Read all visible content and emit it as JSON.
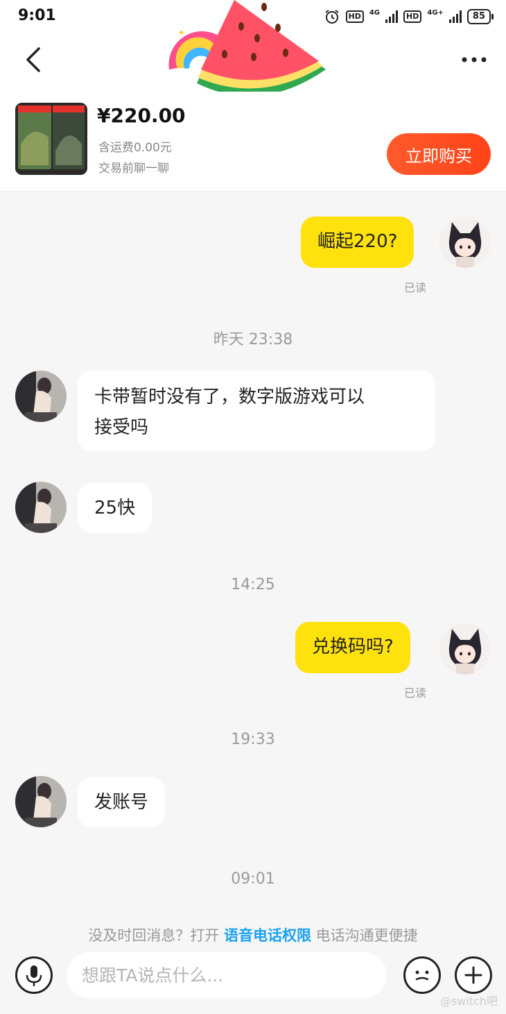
{
  "status_bar": {
    "time": "9:01",
    "hd1": "HD",
    "net1": "4G",
    "hd2": "HD",
    "net2": "4G+",
    "battery": "85"
  },
  "product": {
    "price": "¥220.00",
    "shipping": "含运费0.00元",
    "subtitle": "交易前聊一聊",
    "buy_label": "立即购买"
  },
  "messages": {
    "m1": {
      "text": "崛起220?",
      "status": "已读"
    },
    "ts1": "昨天 23:38",
    "m2": {
      "text_line1": "卡带暂时没有了，数字版游戏可以",
      "text_line2": "接受吗"
    },
    "m3": {
      "text": "25快"
    },
    "ts2": "14:25",
    "m4": {
      "text": "兑换码吗?",
      "status": "已读"
    },
    "ts3": "19:33",
    "m5": {
      "text": "发账号"
    },
    "ts4": "09:01"
  },
  "notice": {
    "prefix": "没及时回消息？打开 ",
    "link": "语音电话权限",
    "suffix": " 电话沟通更便捷"
  },
  "input": {
    "placeholder": "想跟TA说点什么..."
  },
  "watermark": "@switch吧",
  "icons": [
    "back-icon",
    "more-icon",
    "mic-icon",
    "emoji-icon",
    "plus-icon",
    "alarm-icon",
    "signal-icon",
    "battery-icon"
  ],
  "colors": {
    "buy_button": "#ff4d1f",
    "my_bubble": "#ffe20d",
    "link": "#1aa1ef"
  }
}
